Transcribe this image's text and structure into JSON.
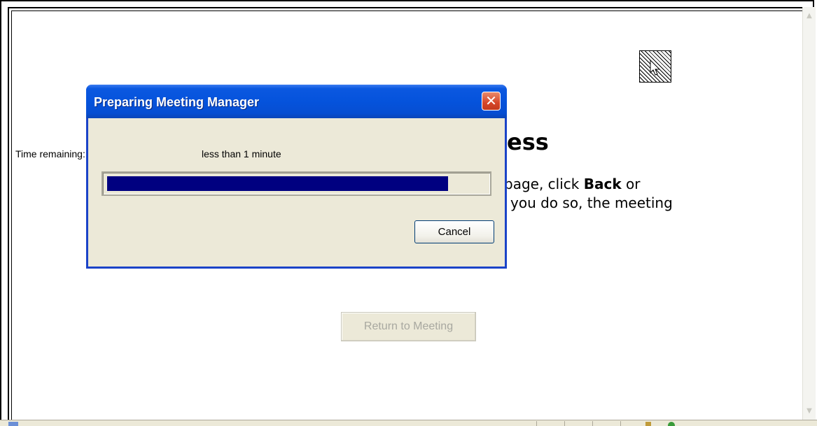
{
  "dialog": {
    "title": "Preparing Meeting Manager",
    "close_glyph": "✕",
    "time_remaining_label": "Time remaining:",
    "time_remaining_value": "less than 1 minute",
    "progress_fraction": 0.9,
    "cancel_label": "Cancel"
  },
  "page": {
    "heading_fragment": "ess",
    "line1_prefix": "page, click ",
    "line1_bold": "Back",
    "line1_suffix": " or",
    "line2": "you do so, the meeting",
    "return_button_label": "Return to Meeting"
  },
  "colors": {
    "titlebar": "#0553dc",
    "progress_fill": "#000080",
    "close_button": "#d6462a"
  },
  "icons": {
    "busy_cursor": "busy-cursor-icon",
    "close": "close-icon"
  }
}
